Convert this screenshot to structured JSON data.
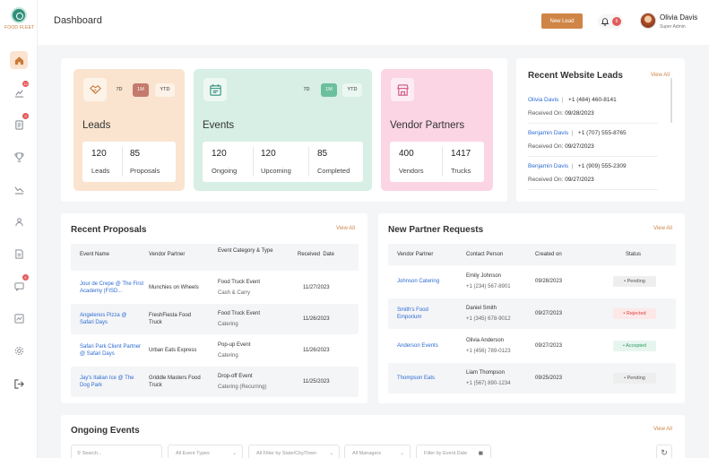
{
  "brand": {
    "logo_text": "FOOD FLEET"
  },
  "sidebar": {
    "badges": {
      "b1": "12",
      "b2": "9",
      "b3": "6"
    }
  },
  "header": {
    "title": "Dashboard",
    "new_lead": "New Lead",
    "notif_count": "6",
    "user_name": "Olivia Davis",
    "user_role": "Super Admin"
  },
  "cards": {
    "leads": {
      "title": "Leads",
      "segments": [
        "7D",
        "1M",
        "YTD"
      ],
      "active": "1M",
      "stats": [
        {
          "value": "120",
          "label": "Leads"
        },
        {
          "value": "85",
          "label": "Proposals"
        }
      ]
    },
    "events": {
      "title": "Events",
      "segments": [
        "7D",
        "1M",
        "YTD"
      ],
      "active": "1M",
      "stats": [
        {
          "value": "120",
          "label": "Ongoing"
        },
        {
          "value": "120",
          "label": "Upcoming"
        },
        {
          "value": "85",
          "label": "Completed"
        }
      ]
    },
    "vendors": {
      "title": "Vendor Partners",
      "stats": [
        {
          "value": "400",
          "label": "Vendors"
        },
        {
          "value": "1417",
          "label": "Trucks"
        }
      ]
    }
  },
  "website_leads": {
    "title": "Recent Website Leads",
    "view_all": "View All",
    "items": [
      {
        "name": "Olivia Davis",
        "phone": "+1 (484) 460-8141",
        "received": "Received On:",
        "date": "09/28/2023"
      },
      {
        "name": "Benjamin Davis",
        "phone": "+1 (707) 555-8765",
        "received": "Received On:",
        "date": "09/27/2023"
      },
      {
        "name": "Benjamin Davis",
        "phone": "+1 (909) 555-2309",
        "received": "Received On:",
        "date": "09/27/2023"
      }
    ]
  },
  "proposals": {
    "title": "Recent Proposals",
    "view_all": "View All",
    "headers": [
      "Event Name",
      "Vendor Partner",
      "Event Category & Type",
      "Received  Date"
    ],
    "rows": [
      {
        "event": "Jour de Crepe @ The First Academy (FISD...",
        "vendor": "Munchies on Wheels",
        "category": "Food Truck Event",
        "type": "Cash & Carry",
        "date": "11/27/2023"
      },
      {
        "event": "Angelenos Pizza @ Safari Days",
        "vendor": "FreshFiesta Food Truck",
        "category": "Food Truck Event",
        "type": "Catering",
        "date": "11/26/2023"
      },
      {
        "event": "Safari Park Client Partner @ Safari Days",
        "vendor": "Urban Eats Express",
        "category": "Pop-up Event",
        "type": "Catering",
        "date": "11/26/2023"
      },
      {
        "event": "Jay's Italian Ice @ The Dog Park",
        "vendor": "Griddle Masters Food Truck",
        "category": "Drop-off Event",
        "type": "Catering (Recurring)",
        "date": "11/25/2023"
      }
    ]
  },
  "partners": {
    "title": "New Partner Requests",
    "view_all": "View All",
    "headers": [
      "Vendor Partner",
      "Contact Person",
      "Created on",
      "Status"
    ],
    "rows": [
      {
        "vendor": "Johnson Catering",
        "contact": "Emily Johnson",
        "phone": "+1 (234) 567-8901",
        "created": "09/28/2023",
        "status": "• Pending"
      },
      {
        "vendor": "Smith's Food Emporium",
        "contact": "Daniel Smith",
        "phone": "+1 (345) 678-9012",
        "created": "09/27/2023",
        "status": "• Rejected"
      },
      {
        "vendor": "Anderson Events",
        "contact": "Olivia Anderson",
        "phone": "+1 (456) 789-0123",
        "created": "09/27/2023",
        "status": "• Accepted"
      },
      {
        "vendor": "Thompson Eats",
        "contact": "Liam Thompson",
        "phone": "+1 (567) 890-1234",
        "created": "09/25/2023",
        "status": "• Pending"
      }
    ]
  },
  "ongoing": {
    "title": "Ongoing Events",
    "view_all": "View All",
    "search_placeholder": "Search...",
    "filters": [
      "All Event Types",
      "All Filter by State/City/Town",
      "All Managers",
      "Filter by Event Date"
    ]
  },
  "colors": {
    "accent": "#cf8546",
    "leads_bg": "#fae4cf",
    "events_bg": "#d7efe5",
    "vendors_bg": "#fbd5e4",
    "link": "#2d6bd1"
  }
}
